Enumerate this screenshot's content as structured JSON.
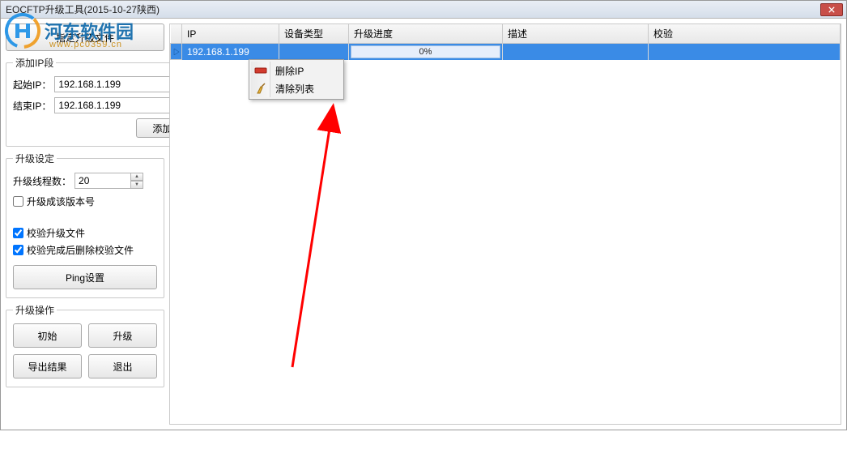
{
  "window": {
    "title": "EOCFTP升级工具(2015-10-27陕西)"
  },
  "watermark": {
    "text": "河东软件园",
    "sub": "www.pc0359.cn"
  },
  "sidebar": {
    "specify_btn": "指定升级文件",
    "add_ip_segment": {
      "legend": "添加IP段",
      "start_label": "起始IP：",
      "start_value": "192.168.1.199",
      "end_label": "结束IP：",
      "end_value": "192.168.1.199",
      "add_btn": "添加"
    },
    "upgrade_settings": {
      "legend": "升级设定",
      "threads_label": "升级线程数：",
      "threads_value": "20",
      "chk_version": "升级成该版本号",
      "chk_verify": "校验升级文件",
      "chk_delverify": "校验完成后删除校验文件",
      "ping_btn": "Ping设置"
    },
    "upgrade_ops": {
      "legend": "升级操作",
      "init_btn": "初始",
      "upgrade_btn": "升级",
      "export_btn": "导出结果",
      "exit_btn": "退出"
    }
  },
  "grid": {
    "headers": {
      "ip": "IP",
      "type": "设备类型",
      "progress": "升级进度",
      "desc": "描述",
      "verify": "校验"
    },
    "rows": [
      {
        "ip": "192.168.1.199",
        "type": "",
        "progress": "0%",
        "desc": "",
        "verify": ""
      }
    ]
  },
  "context_menu": {
    "delete_ip": "删除IP",
    "clear_list": "清除列表"
  }
}
